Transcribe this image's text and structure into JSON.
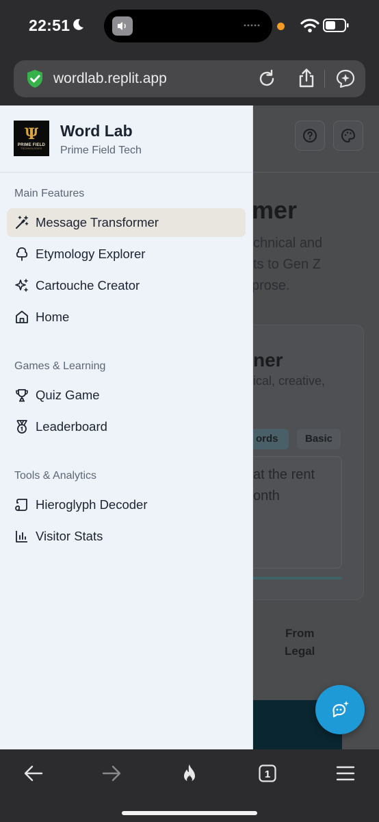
{
  "status_bar": {
    "time": "22:51"
  },
  "browser": {
    "url": "wordlab.replit.app",
    "tab_count": "1"
  },
  "sidebar": {
    "title": "Word Lab",
    "subtitle": "Prime Field Tech",
    "logo": {
      "glyph": "Ψ",
      "line1": "PRIME FIELD",
      "line2": "TECHNOLOGIES"
    },
    "sections": [
      {
        "label": "Main Features",
        "items": [
          {
            "label": "Message Transformer",
            "icon": "magic-wand-icon",
            "active": true
          },
          {
            "label": "Etymology Explorer",
            "icon": "tree-icon",
            "active": false
          },
          {
            "label": "Cartouche Creator",
            "icon": "sparkles-icon",
            "active": false
          },
          {
            "label": "Home",
            "icon": "home-icon",
            "active": false
          }
        ]
      },
      {
        "label": "Games & Learning",
        "items": [
          {
            "label": "Quiz Game",
            "icon": "trophy-icon",
            "active": false
          },
          {
            "label": "Leaderboard",
            "icon": "medal-icon",
            "active": false
          }
        ]
      },
      {
        "label": "Tools & Analytics",
        "items": [
          {
            "label": "Hieroglyph Decoder",
            "icon": "scroll-icon",
            "active": false
          },
          {
            "label": "Visitor Stats",
            "icon": "bar-chart-icon",
            "active": false
          }
        ]
      }
    ]
  },
  "background_page": {
    "heading_fragment": "mer",
    "desc_lines": [
      "chnical and",
      "ts to Gen Z",
      "prose."
    ],
    "card_title_fragment": "ner",
    "card_sub_fragment": "ical, creative,",
    "chips": [
      "ords",
      "Basic"
    ],
    "text_lines": [
      "at the rent",
      "onth"
    ],
    "from_label_line1": "From",
    "from_label_line2": "Legal"
  },
  "colors": {
    "sidebar_bg": "#eef3f9",
    "active_item_bg": "#e9e5df",
    "fab_bg": "#1e9ad6",
    "browser_chrome": "#2c2c2e"
  }
}
